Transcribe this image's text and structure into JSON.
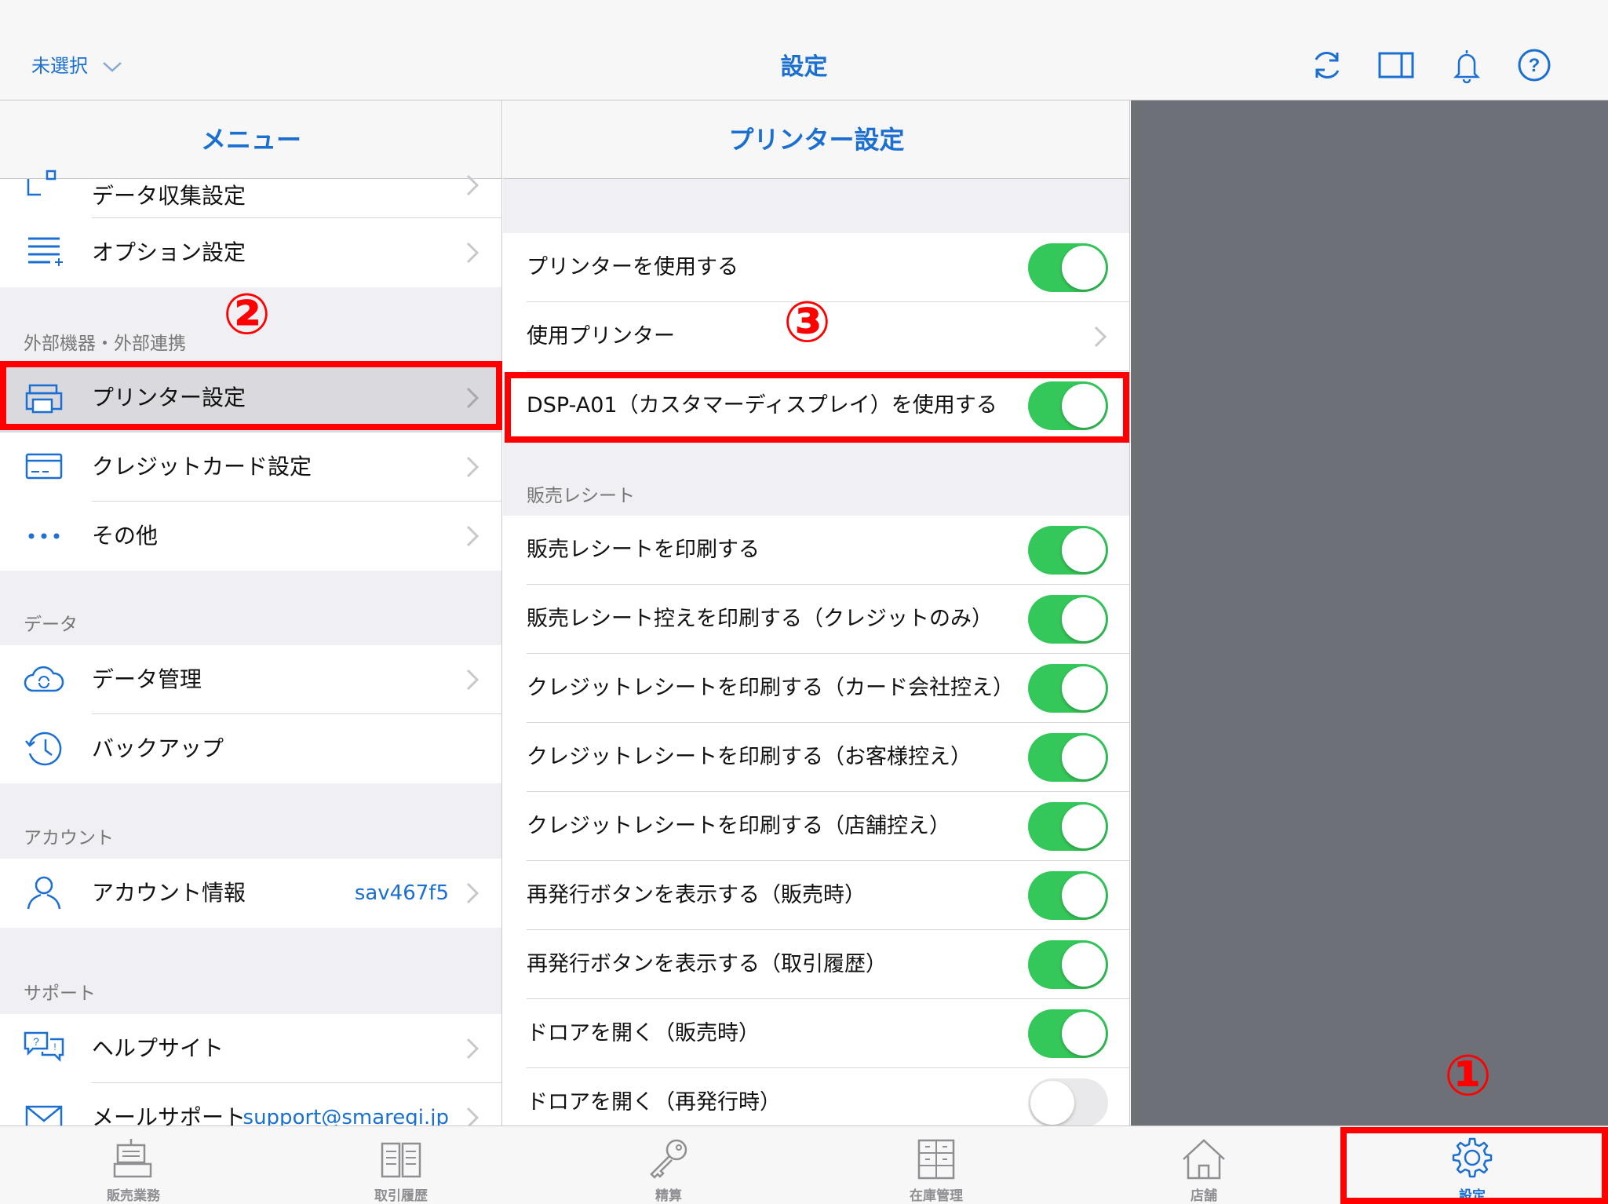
{
  "header": {
    "store_selector": "未選択",
    "title": "設定",
    "icons": [
      "sync-icon",
      "split-view-icon",
      "bell-icon",
      "help-icon"
    ]
  },
  "menu": {
    "title": "メニュー",
    "items_top": [
      {
        "label": "データ収集設定",
        "icon": "data-collection-icon"
      },
      {
        "label": "オプション設定",
        "icon": "options-list-icon"
      }
    ],
    "sections": [
      {
        "header": "外部機器・外部連携",
        "items": [
          {
            "label": "プリンター設定",
            "icon": "printer-icon",
            "selected": true
          },
          {
            "label": "クレジットカード設定",
            "icon": "credit-card-icon"
          },
          {
            "label": "その他",
            "icon": "more-dots-icon"
          }
        ]
      },
      {
        "header": "データ",
        "items": [
          {
            "label": "データ管理",
            "icon": "cloud-sync-icon"
          },
          {
            "label": "バックアップ",
            "icon": "history-clock-icon"
          }
        ]
      },
      {
        "header": "アカウント",
        "items": [
          {
            "label": "アカウント情報",
            "value": "sav467f5",
            "icon": "person-icon"
          }
        ]
      },
      {
        "header": "サポート",
        "items": [
          {
            "label": "ヘルプサイト",
            "icon": "help-chat-icon"
          },
          {
            "label": "メールサポート",
            "value": "support@smaregi.jp",
            "icon": "mail-icon"
          }
        ]
      }
    ]
  },
  "printer": {
    "title": "プリンター設定",
    "rows_top": [
      {
        "label": "プリンターを使用する",
        "toggle": true
      },
      {
        "label": "使用プリンター",
        "chevron": true
      },
      {
        "label": "DSP-A01（カスタマーディスプレイ）を使用する",
        "toggle": true
      }
    ],
    "receipt_section": "販売レシート",
    "receipt_rows": [
      {
        "label": "販売レシートを印刷する",
        "toggle": true
      },
      {
        "label": "販売レシート控えを印刷する（クレジットのみ）",
        "toggle": true
      },
      {
        "label": "クレジットレシートを印刷する（カード会社控え）",
        "toggle": true
      },
      {
        "label": "クレジットレシートを印刷する（お客様控え）",
        "toggle": true
      },
      {
        "label": "クレジットレシートを印刷する（店舗控え）",
        "toggle": true
      },
      {
        "label": "再発行ボタンを表示する（販売時）",
        "toggle": true
      },
      {
        "label": "再発行ボタンを表示する（取引履歴）",
        "toggle": true
      },
      {
        "label": "ドロアを開く（販売時）",
        "toggle": true
      },
      {
        "label": "ドロアを開く（再発行時）",
        "toggle": false
      }
    ]
  },
  "tabbar": {
    "tabs": [
      {
        "label": "販売業務",
        "icon": "register-icon"
      },
      {
        "label": "取引履歴",
        "icon": "book-icon"
      },
      {
        "label": "精算",
        "icon": "key-icon"
      },
      {
        "label": "在庫管理",
        "icon": "cabinet-icon"
      },
      {
        "label": "店舗",
        "icon": "store-icon"
      },
      {
        "label": "設定",
        "icon": "gear-icon",
        "active": true
      }
    ]
  },
  "annotations": {
    "one": "①",
    "two": "②",
    "three": "③"
  },
  "colors": {
    "accent": "#1a6fd0",
    "toggle_on": "#34c759",
    "annotation": "#ff0000",
    "detail_background": "#6e7078"
  }
}
